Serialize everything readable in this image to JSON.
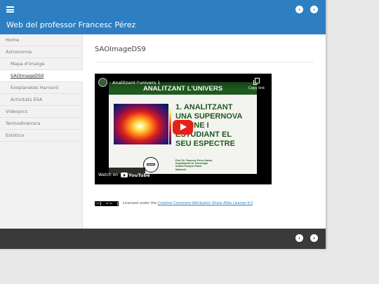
{
  "header": {
    "site_title": "Web del professor Francesc Pérez",
    "prev_icon": "chevron-left-icon",
    "next_icon": "chevron-right-icon",
    "background": "#2d7fc1"
  },
  "sidebar": {
    "items": [
      {
        "label": "Home"
      },
      {
        "label": "Astronomia"
      },
      {
        "label": "Mapa d'imatge"
      },
      {
        "label": "SAOImageDS9"
      },
      {
        "label": "Exoplanetes Harvard"
      },
      {
        "label": "Activitats ESA"
      },
      {
        "label": "Videojocs"
      },
      {
        "label": "Termodinàmica"
      },
      {
        "label": "Estàtica"
      }
    ],
    "active_item": "SAOImageDS9"
  },
  "main": {
    "page_title": "SAOImageDS9",
    "video": {
      "title": "Analitzant l'univers 1",
      "copy_link_label": "Copy link",
      "watch_on_label": "Watch on",
      "youtube_label": "YouTube",
      "slide": {
        "band_text": "ANALITZANT L'UNIVERS",
        "heading_lines": [
          "1. ANALITZANT",
          "UNA SUPERNOVA",
          "ONLINE I",
          "ESTUDIANT EL",
          "SEU ESPECTRE"
        ],
        "author_lines": [
          "Prof. Dr. Francesc Pérez García",
          "Departament de Tecnologia",
          "Institut Pompeu Fabra",
          "Martorell"
        ]
      }
    },
    "license": {
      "badge_text": "BY  SA",
      "prefix": "Licensed under the ",
      "link_text": "Creative Commons Attribution Share Alike License 4.0"
    }
  },
  "footer": {
    "prev_icon": "chevron-left-icon",
    "next_icon": "chevron-right-icon",
    "background": "#3a3a3a"
  }
}
